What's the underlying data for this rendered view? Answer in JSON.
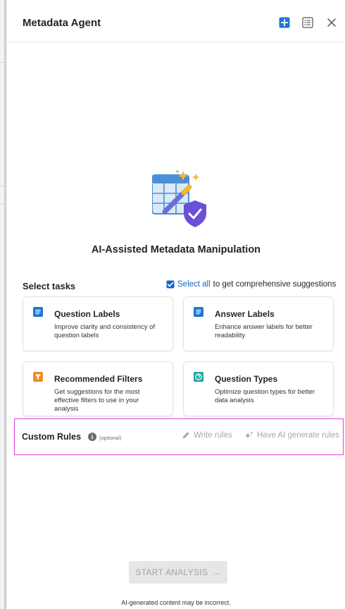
{
  "header": {
    "title": "Metadata Agent",
    "icons": [
      "add-icon",
      "list-icon",
      "close-icon"
    ]
  },
  "hero": {
    "icon": "ai-metadata-table-icon",
    "title": "AI-Assisted Metadata Manipulation"
  },
  "tasks": {
    "heading": "Select tasks",
    "select_all_label": "Select all",
    "select_all_suffix": "to get comprehensive suggestions",
    "cards": [
      {
        "title": "Question Labels",
        "description": "Improve clarity and consistency of question labels",
        "icon": "question-labels-icon",
        "color": "#1f78d1"
      },
      {
        "title": "Answer Labels",
        "description": "Enhance answer labels for better readability",
        "icon": "answer-labels-icon",
        "color": "#1f78d1"
      },
      {
        "title": "Recommended Filters",
        "description": "Get suggestions for the most effective filters to use in your analysis",
        "icon": "filter-icon",
        "color": "#f08c28"
      },
      {
        "title": "Question Types",
        "description": "Optimize question types for better data analysis",
        "icon": "question-types-icon",
        "color": "#1aa5a6"
      }
    ]
  },
  "custom_rules": {
    "title": "Custom Rules",
    "optional": "(optional)",
    "write_label": "Write rules",
    "ai_label": "Have AI generate rules"
  },
  "actions": {
    "start_label": "START ANALYSIS",
    "start_arrow": "→"
  },
  "footer": {
    "disclaimer": "AI-generated content may be incorrect."
  },
  "colors": {
    "accent": "#1264c9",
    "highlight_border": "#e23ee2",
    "disabled_bg": "#e6e6e6"
  }
}
